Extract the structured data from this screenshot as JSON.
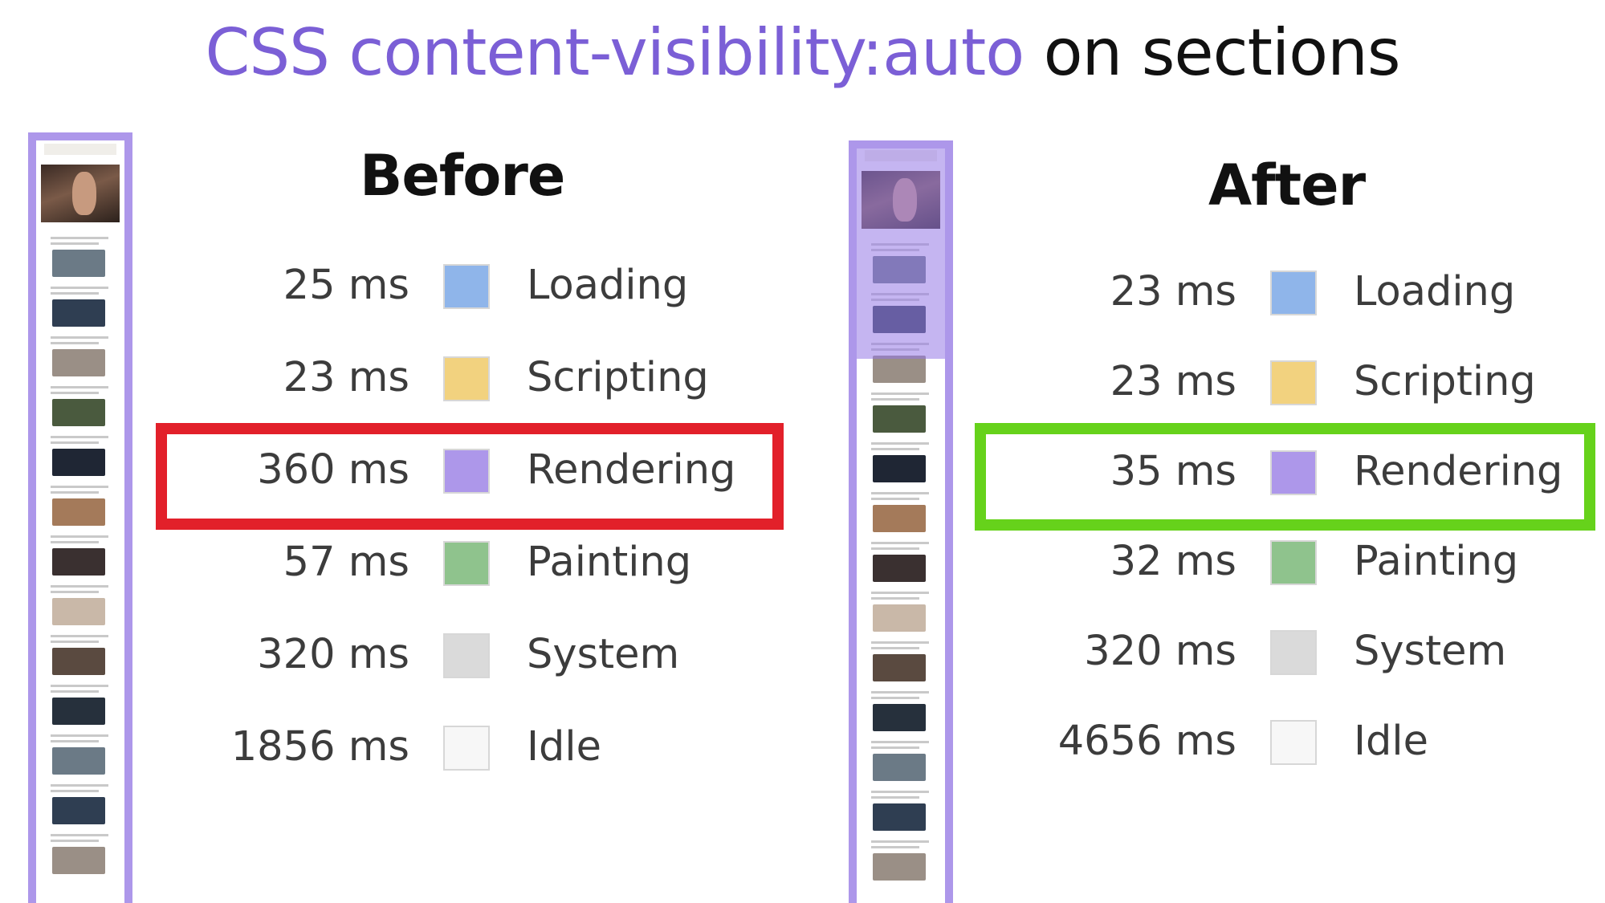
{
  "title": {
    "highlight": "CSS content-visibility:auto",
    "rest": "on sections",
    "highlight_color": "#7b5fd6"
  },
  "chart_data": [
    {
      "type": "table",
      "title": "Before",
      "unit": "ms",
      "rows": [
        {
          "label": "Loading",
          "value": 25,
          "display": "25 ms",
          "color": "#8fb5ea"
        },
        {
          "label": "Scripting",
          "value": 23,
          "display": "23 ms",
          "color": "#f2d27f"
        },
        {
          "label": "Rendering",
          "value": 360,
          "display": "360 ms",
          "color": "#ad97ea",
          "highlighted": true
        },
        {
          "label": "Painting",
          "value": 57,
          "display": "57 ms",
          "color": "#8fc38d"
        },
        {
          "label": "System",
          "value": 320,
          "display": "320 ms",
          "color": "#dadada"
        },
        {
          "label": "Idle",
          "value": 1856,
          "display": "1856 ms",
          "color": "#f7f7f7"
        }
      ],
      "highlight_color": "#e2202a"
    },
    {
      "type": "table",
      "title": "After",
      "unit": "ms",
      "rows": [
        {
          "label": "Loading",
          "value": 23,
          "display": "23 ms",
          "color": "#8fb5ea"
        },
        {
          "label": "Scripting",
          "value": 23,
          "display": "23 ms",
          "color": "#f2d27f"
        },
        {
          "label": "Rendering",
          "value": 35,
          "display": "35 ms",
          "color": "#ad97ea",
          "highlighted": true
        },
        {
          "label": "Painting",
          "value": 32,
          "display": "32 ms",
          "color": "#8fc38d"
        },
        {
          "label": "System",
          "value": 320,
          "display": "320 ms",
          "color": "#dadada"
        },
        {
          "label": "Idle",
          "value": 4656,
          "display": "4656 ms",
          "color": "#f7f7f7"
        }
      ],
      "highlight_color": "#66d21b"
    }
  ],
  "thumbnail_colors": {
    "border": "#ad97ea"
  }
}
